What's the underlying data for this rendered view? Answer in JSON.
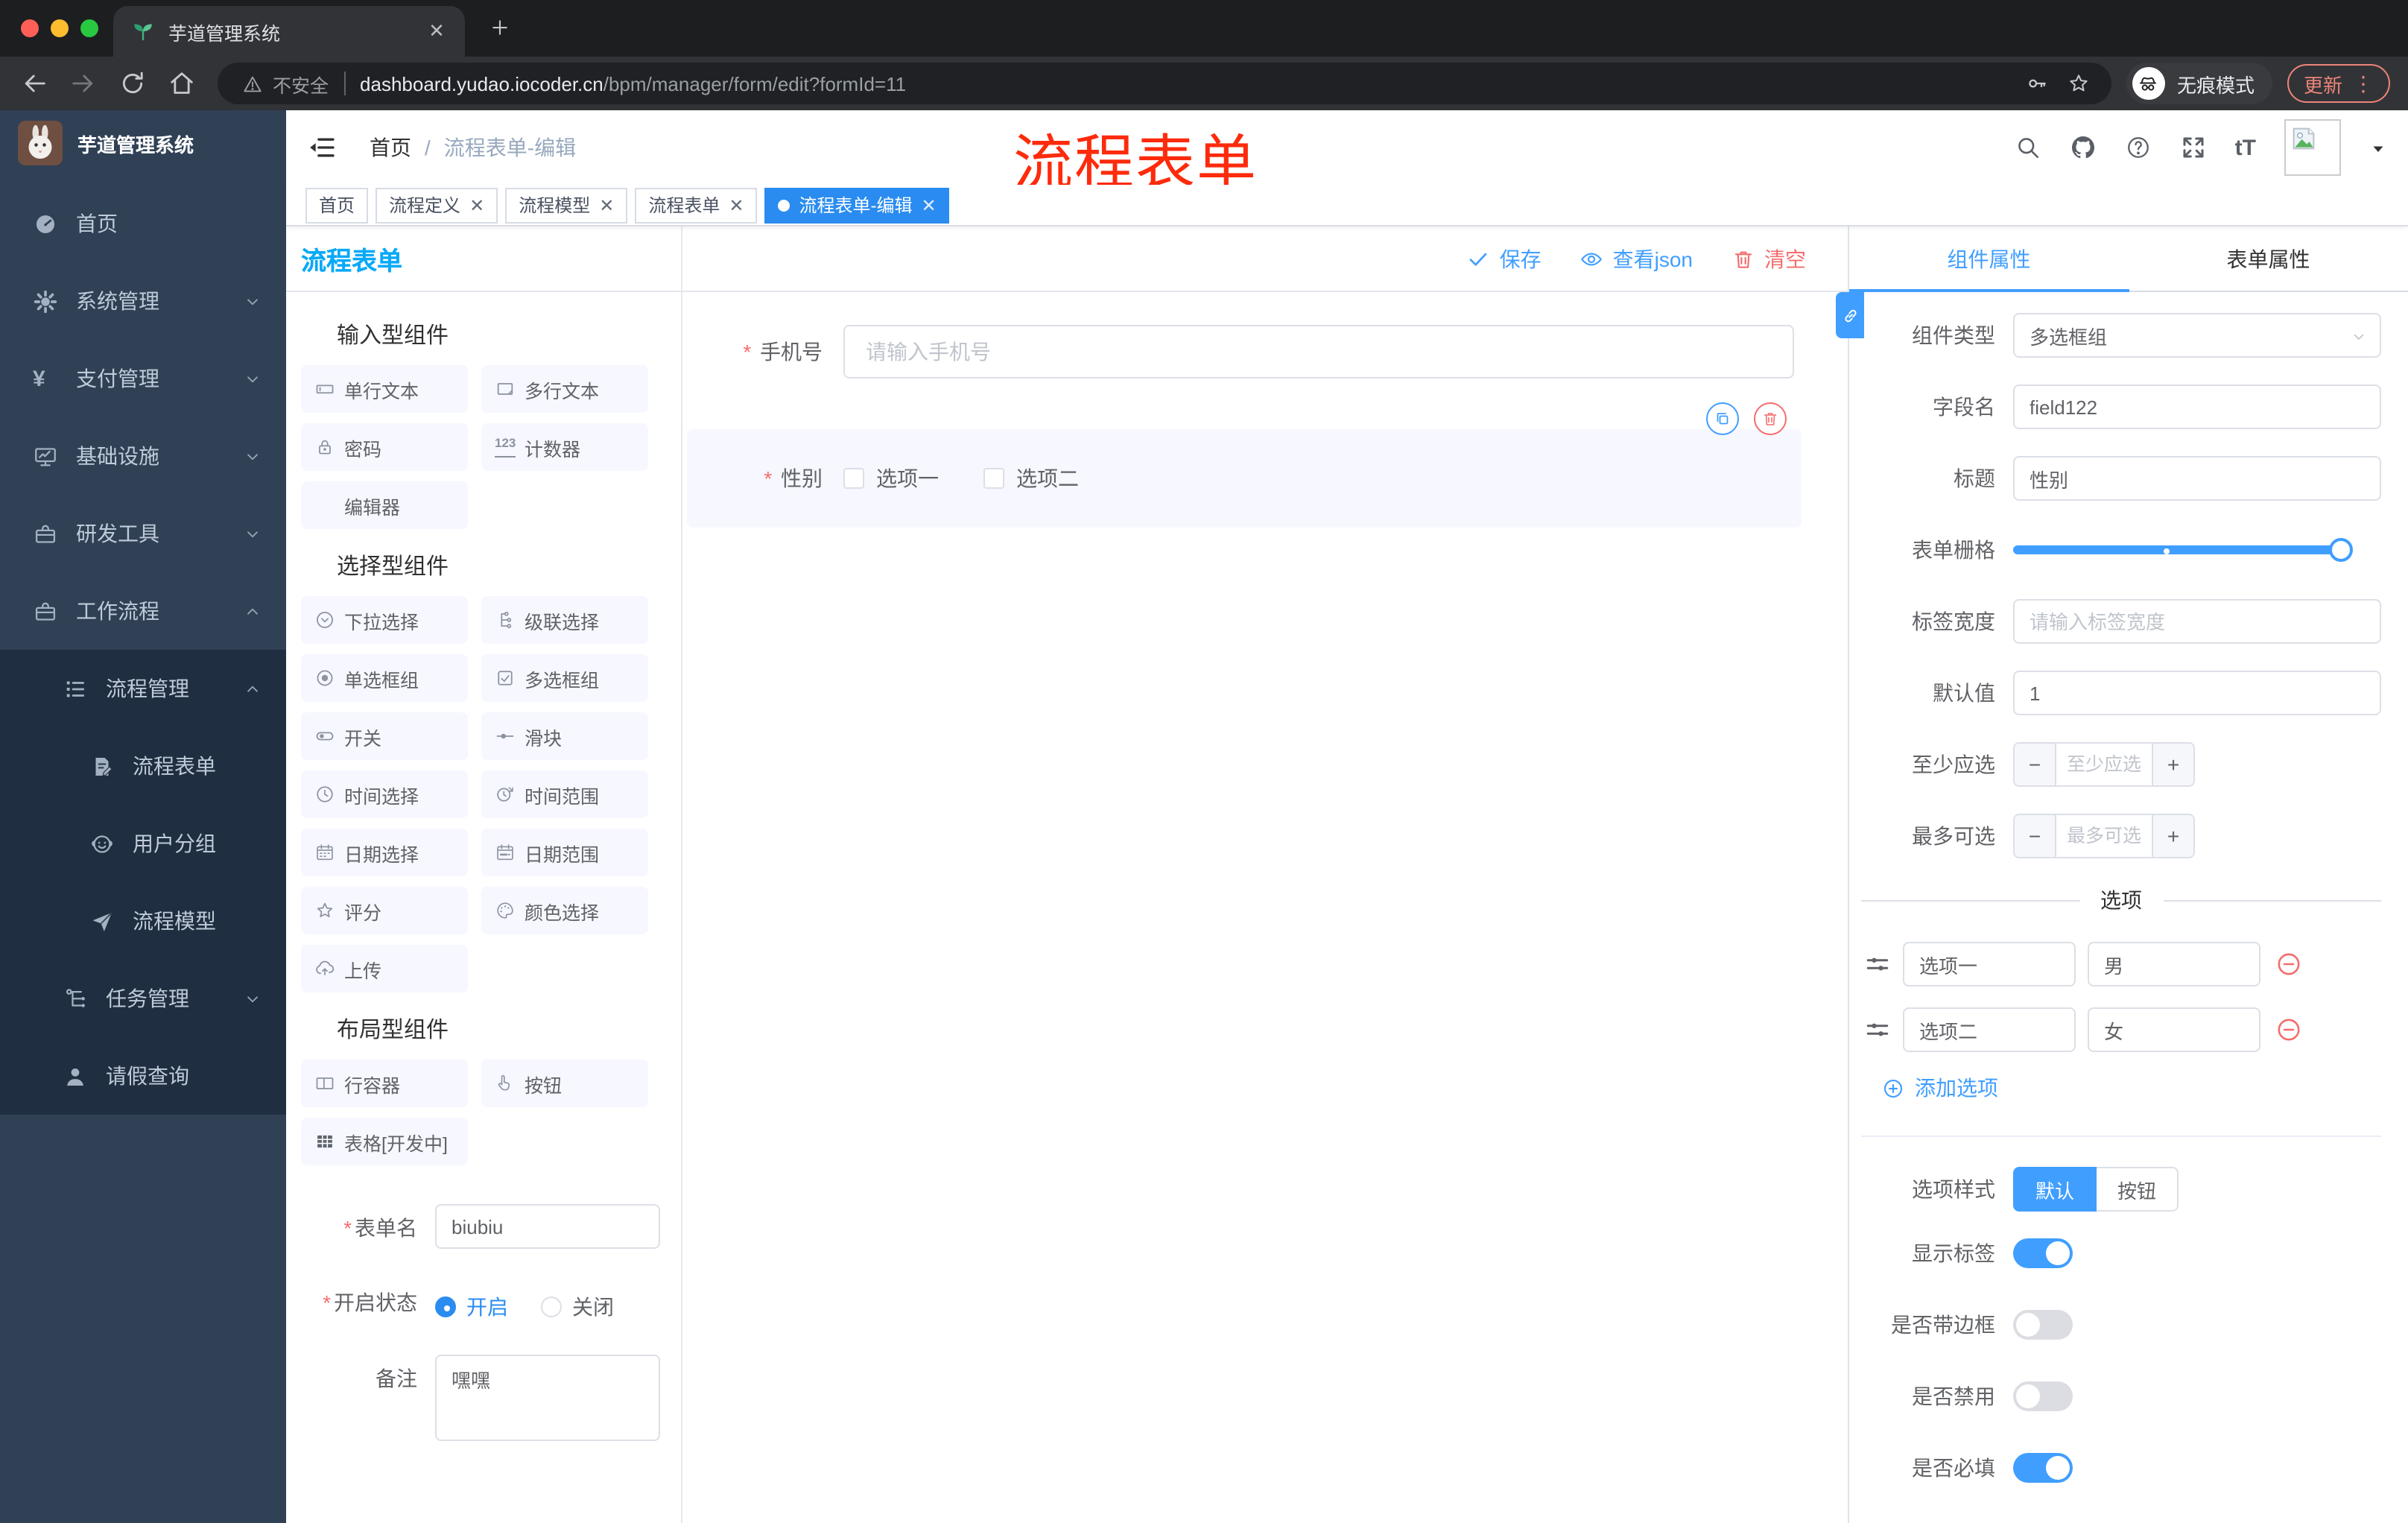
{
  "colors": {
    "primary": "#409eff",
    "danger": "#f56c6c",
    "panel_title_blue": "#09a9f8",
    "annotation_red": "#fd2b0c",
    "tag_active_blue": "#2a8cf0",
    "sidebar_bg": "#304156",
    "submenu_bg": "#202e41"
  },
  "browser": {
    "tab_title": "芋道管理系统",
    "security_label": "不安全",
    "url_host": "dashboard.yudao.iocoder.cn",
    "url_path": "/bpm/manager/form/edit?formId=11",
    "incognito_label": "无痕模式",
    "update_label": "更新"
  },
  "sidebar": {
    "logo_title": "芋道管理系统",
    "items": [
      {
        "key": "home",
        "label": "首页",
        "icon": "dashboard-icon",
        "level": 1,
        "chevron": "",
        "dark": false
      },
      {
        "key": "system",
        "label": "系统管理",
        "icon": "gear-icon",
        "level": 1,
        "chevron": "down",
        "dark": false
      },
      {
        "key": "payment",
        "label": "支付管理",
        "icon": "yen-icon",
        "level": 1,
        "chevron": "down",
        "dark": false
      },
      {
        "key": "infrastructure",
        "label": "基础设施",
        "icon": "monitor-icon",
        "level": 1,
        "chevron": "down",
        "dark": false
      },
      {
        "key": "devtools",
        "label": "研发工具",
        "icon": "briefcase-icon",
        "level": 1,
        "chevron": "down",
        "dark": false
      },
      {
        "key": "workflow",
        "label": "工作流程",
        "icon": "briefcase-icon",
        "level": 1,
        "chevron": "up",
        "dark": false
      },
      {
        "key": "process-mgmt",
        "label": "流程管理",
        "icon": "list-tree-icon",
        "level": 2,
        "chevron": "up",
        "dark": true
      },
      {
        "key": "process-form",
        "label": "流程表单",
        "icon": "document-edit-icon",
        "level": 3,
        "chevron": "",
        "dark": true
      },
      {
        "key": "user-group",
        "label": "用户分组",
        "icon": "robot-icon",
        "level": 3,
        "chevron": "",
        "dark": true
      },
      {
        "key": "process-model",
        "label": "流程模型",
        "icon": "paper-plane-icon",
        "level": 3,
        "chevron": "",
        "dark": true
      },
      {
        "key": "task-mgmt",
        "label": "任务管理",
        "icon": "tree-icon",
        "level": 2,
        "chevron": "down",
        "dark": true
      },
      {
        "key": "leave-query",
        "label": "请假查询",
        "icon": "user-icon",
        "level": 2,
        "chevron": "",
        "dark": true
      }
    ]
  },
  "navbar": {
    "breadcrumb": [
      "首页",
      "流程表单-编辑"
    ],
    "annotation": "流程表单"
  },
  "tagbar": {
    "tags": [
      {
        "label": "首页",
        "closable": false,
        "active": false
      },
      {
        "label": "流程定义",
        "closable": true,
        "active": false
      },
      {
        "label": "流程模型",
        "closable": true,
        "active": false
      },
      {
        "label": "流程表单",
        "closable": true,
        "active": false
      },
      {
        "label": "流程表单-编辑",
        "closable": true,
        "active": true
      }
    ]
  },
  "builder": {
    "panel_title": "流程表单",
    "sections": [
      {
        "title": "输入型组件",
        "icon": "puzzle-icon",
        "items": [
          {
            "label": "单行文本",
            "icon": "input-icon"
          },
          {
            "label": "多行文本",
            "icon": "textarea-icon"
          },
          {
            "label": "密码",
            "icon": "lock-icon"
          },
          {
            "label": "计数器",
            "icon": "counter-icon"
          },
          {
            "label": "编辑器",
            "icon": "none"
          }
        ]
      },
      {
        "title": "选择型组件",
        "icon": "puzzle-icon",
        "items": [
          {
            "label": "下拉选择",
            "icon": "select-icon"
          },
          {
            "label": "级联选择",
            "icon": "cascader-icon"
          },
          {
            "label": "单选框组",
            "icon": "radio-icon"
          },
          {
            "label": "多选框组",
            "icon": "checkbox-icon"
          },
          {
            "label": "开关",
            "icon": "switch-icon"
          },
          {
            "label": "滑块",
            "icon": "slider-icon"
          },
          {
            "label": "时间选择",
            "icon": "time-icon"
          },
          {
            "label": "时间范围",
            "icon": "time-range-icon"
          },
          {
            "label": "日期选择",
            "icon": "date-icon"
          },
          {
            "label": "日期范围",
            "icon": "date-range-icon"
          },
          {
            "label": "评分",
            "icon": "star-icon"
          },
          {
            "label": "颜色选择",
            "icon": "palette-icon"
          },
          {
            "label": "上传",
            "icon": "upload-icon"
          }
        ]
      },
      {
        "title": "布局型组件",
        "icon": "puzzle-icon",
        "items": [
          {
            "label": "行容器",
            "icon": "row-icon"
          },
          {
            "label": "按钮",
            "icon": "button-icon"
          },
          {
            "label": "表格[开发中]",
            "icon": "table-icon"
          }
        ]
      }
    ],
    "form_name": {
      "label": "表单名",
      "required": true,
      "value": "biubiu"
    },
    "status": {
      "label": "开启状态",
      "required": true,
      "options": [
        {
          "label": "开启",
          "selected": true
        },
        {
          "label": "关闭",
          "selected": false
        }
      ]
    },
    "remark": {
      "label": "备注",
      "value": "嘿嘿"
    }
  },
  "canvas": {
    "actions": [
      {
        "key": "save",
        "label": "保存",
        "icon": "check-icon",
        "color": "blue"
      },
      {
        "key": "view-json",
        "label": "查看json",
        "icon": "eye-icon",
        "color": "blue"
      },
      {
        "key": "clear",
        "label": "清空",
        "icon": "trash-icon",
        "color": "red"
      }
    ],
    "phone_field": {
      "label": "手机号",
      "required": true,
      "placeholder": "请输入手机号"
    },
    "gender_field": {
      "label": "性别",
      "required": true,
      "options": [
        "选项一",
        "选项二"
      ]
    }
  },
  "inspector": {
    "tabs": [
      {
        "label": "组件属性",
        "active": true
      },
      {
        "label": "表单属性",
        "active": false
      }
    ],
    "fields": {
      "component_type": {
        "label": "组件类型",
        "value": "多选框组"
      },
      "field_name": {
        "label": "字段名",
        "value": "field122"
      },
      "title": {
        "label": "标题",
        "value": "性别"
      },
      "grid": {
        "label": "表单栅格"
      },
      "label_width": {
        "label": "标签宽度",
        "placeholder": "请输入标签宽度",
        "value": ""
      },
      "default_value": {
        "label": "默认值",
        "value": "1"
      },
      "min_select": {
        "label": "至少应选",
        "placeholder": "至少应选",
        "value": ""
      },
      "max_select": {
        "label": "最多可选",
        "placeholder": "最多可选",
        "value": ""
      }
    },
    "options_section": {
      "title": "选项",
      "rows": [
        {
          "label": "选项一",
          "value": "男"
        },
        {
          "label": "选项二",
          "value": "女"
        }
      ],
      "add_label": "添加选项"
    },
    "style_section": {
      "label": "选项样式",
      "buttons": [
        {
          "label": "默认",
          "active": true
        },
        {
          "label": "按钮",
          "active": false
        }
      ]
    },
    "switches": [
      {
        "key": "show-label",
        "label": "显示标签",
        "on": true
      },
      {
        "key": "with-border",
        "label": "是否带边框",
        "on": false
      },
      {
        "key": "disabled",
        "label": "是否禁用",
        "on": false
      },
      {
        "key": "required",
        "label": "是否必填",
        "on": true
      }
    ]
  }
}
